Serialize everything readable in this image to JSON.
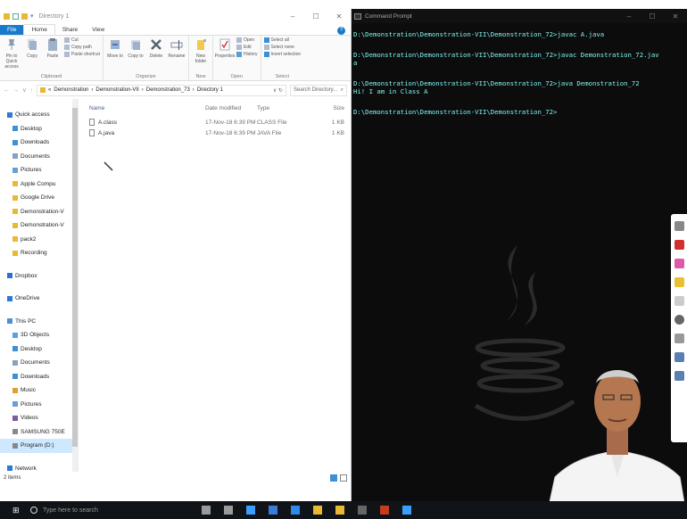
{
  "explorer": {
    "title": "Directory 1",
    "window_buttons": [
      "–",
      "☐",
      "✕"
    ],
    "tabs": [
      "File",
      "Home",
      "Share",
      "View"
    ],
    "help": "?",
    "ribbon": {
      "clipboard": {
        "label": "Clipboard",
        "pin": "Pin to Quick access",
        "copy": "Copy",
        "paste": "Paste",
        "cut": "Cut",
        "copy_path": "Copy path",
        "paste_shortcut": "Paste shortcut"
      },
      "organize": {
        "label": "Organize",
        "move_to": "Move to",
        "copy_to": "Copy to",
        "delete": "Delete",
        "rename": "Rename"
      },
      "new": {
        "label": "New",
        "new_folder": "New folder"
      },
      "open": {
        "label": "Open",
        "properties": "Properties",
        "open": "Open",
        "edit": "Edit",
        "history": "History"
      },
      "select": {
        "label": "Select",
        "select_all": "Select all",
        "select_none": "Select none",
        "invert": "Invert selection"
      }
    },
    "breadcrumb": [
      "Demonstration",
      "Demonstration-VII",
      "Demonstration_73",
      "Directory 1"
    ],
    "search_placeholder": "Search Directory...",
    "nav": [
      {
        "label": "Quick access",
        "level": 1,
        "color": "#2b7bd6"
      },
      {
        "label": "Desktop",
        "level": 2,
        "color": "#3d8fd6"
      },
      {
        "label": "Downloads",
        "level": 2,
        "color": "#3d8fd6"
      },
      {
        "label": "Documents",
        "level": 2,
        "color": "#8aa1bd"
      },
      {
        "label": "Pictures",
        "level": 2,
        "color": "#6a9fd6"
      },
      {
        "label": "Apple Compu",
        "level": 2,
        "color": "#e8b933"
      },
      {
        "label": "Google Drive",
        "level": 2,
        "color": "#e8b933"
      },
      {
        "label": "Demonstration-V",
        "level": 2,
        "color": "#e8b933"
      },
      {
        "label": "Demonstration-V",
        "level": 2,
        "color": "#e8b933"
      },
      {
        "label": "pack2",
        "level": 2,
        "color": "#e8b933"
      },
      {
        "label": "Recording",
        "level": 2,
        "color": "#e8b933"
      },
      {
        "gap": true
      },
      {
        "label": "Dropbox",
        "level": 1,
        "color": "#2b6ed6"
      },
      {
        "gap": true
      },
      {
        "label": "OneDrive",
        "level": 1,
        "color": "#2b7bd6"
      },
      {
        "gap": true
      },
      {
        "label": "This PC",
        "level": 1,
        "color": "#4a90d9"
      },
      {
        "label": "3D Objects",
        "level": 2,
        "color": "#5aa0e0"
      },
      {
        "label": "Desktop",
        "level": 2,
        "color": "#3d8fd6"
      },
      {
        "label": "Documents",
        "level": 2,
        "color": "#8aa1bd"
      },
      {
        "label": "Downloads",
        "level": 2,
        "color": "#3d8fd6"
      },
      {
        "label": "Music",
        "level": 2,
        "color": "#e0a030"
      },
      {
        "label": "Pictures",
        "level": 2,
        "color": "#6a9fd6"
      },
      {
        "label": "Videos",
        "level": 2,
        "color": "#7a5aa0"
      },
      {
        "label": "SAMSUNG 750E",
        "level": 2,
        "color": "#888888"
      },
      {
        "label": "Program (D:)",
        "level": 2,
        "color": "#888888",
        "selected": true
      },
      {
        "gap": true
      },
      {
        "label": "Network",
        "level": 1,
        "color": "#2b7bd6"
      }
    ],
    "columns": {
      "name": "Name",
      "date": "Date modified",
      "type": "Type",
      "size": "Size"
    },
    "files": [
      {
        "name": "A.class",
        "date": "17-Nov-18 6:39 PM",
        "type": "CLASS File",
        "size": "1 KB"
      },
      {
        "name": "A.java",
        "date": "17-Nov-18 6:39 PM",
        "type": "JAVA File",
        "size": "1 KB"
      }
    ],
    "status": "2 items"
  },
  "cmd": {
    "title": "Command Prompt",
    "lines": [
      {
        "cmd": "D:\\Demonstration\\Demonstration-VII\\Demonstration_72>javac A.java"
      },
      {
        "cmd": "D:\\Demonstration\\Demonstration-VII\\Demonstration_72>javac Demonstration_72.jav\na"
      },
      {
        "cmd": "D:\\Demonstration\\Demonstration-VII\\Demonstration_72>java Demonstration_72",
        "out": "Hi! I am in Class A"
      },
      {
        "cmd": "D:\\Demonstration\\Demonstration-VII\\Demonstration_72>"
      }
    ]
  },
  "taskbar": {
    "search_placeholder": "Type here to search",
    "apps": [
      "mic-icon",
      "task-view-icon",
      "cortana-icon",
      "store-icon",
      "edge-icon",
      "chrome-icon",
      "file-explorer-icon",
      "terminal-icon",
      "powerpoint-icon",
      "video-app-icon"
    ],
    "app_colors": [
      "#9a9a9a",
      "#9a9a9a",
      "#3aa0ff",
      "#3a7bd6",
      "#2e8ae6",
      "#e8b933",
      "#e8b933",
      "#666666",
      "#c43e1c",
      "#3aa0ff"
    ]
  },
  "colors": {
    "file_tab": "#1979ca",
    "console_text": "#7ff4f4",
    "taskbar": "#101317"
  }
}
